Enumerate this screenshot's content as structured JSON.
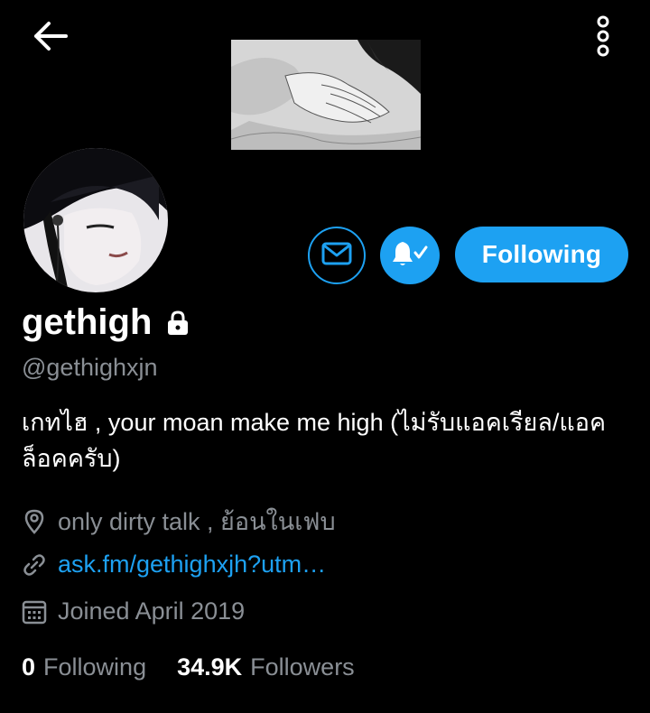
{
  "colors": {
    "background": "#000000",
    "accent": "#1da1f2",
    "secondary_text": "#8a8f95",
    "primary_text": "#ffffff"
  },
  "header": {
    "back_icon": "arrow-left-icon",
    "more_icon": "vertical-dots-icon"
  },
  "profile": {
    "display_name": "gethigh",
    "protected_icon": "lock-icon",
    "handle": "@gethighxjn",
    "bio": "เกทไฮ , your moan make me high (ไม่รับแอคเรียล/แอคล็อคครับ)",
    "actions": {
      "message_icon": "envelope-icon",
      "notifications_icon": "bell-check-icon",
      "follow_label": "Following"
    },
    "location": "only dirty talk , ย้อนในเฟบ",
    "location_icon": "map-pin-icon",
    "website": "ask.fm/gethighxjh?utm…",
    "website_icon": "link-icon",
    "joined": "Joined April 2019",
    "joined_icon": "calendar-icon",
    "stats": {
      "following_count": "0",
      "following_label": "Following",
      "followers_count": "34.9K",
      "followers_label": "Followers"
    }
  }
}
